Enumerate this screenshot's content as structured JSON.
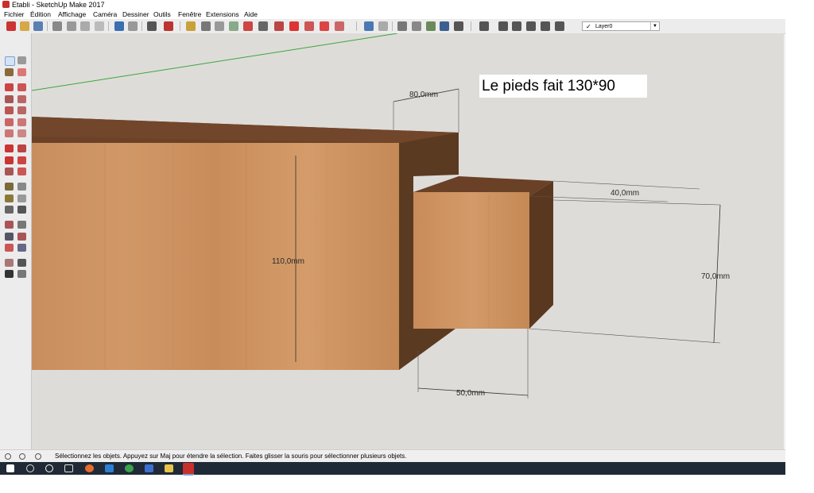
{
  "window": {
    "title": "Etabli - SketchUp Make 2017"
  },
  "menu": [
    "Fichier",
    "Édition",
    "Affichage",
    "Caméra",
    "Dessiner",
    "Outils",
    "Fenêtre",
    "Extensions",
    "Aide"
  ],
  "layer_selector": {
    "value": "Layer0",
    "check": "✓"
  },
  "viewport": {
    "note": "Le pieds fait 130*90",
    "dimensions": [
      "80,0mm",
      "40,0mm",
      "110,0mm",
      "70,0mm",
      "50,0mm"
    ],
    "colors": {
      "background": "#dedcd9",
      "wood_front": "#c98f5f",
      "wood_top": "#6a4126",
      "wood_side": "#5a3a22",
      "axis_green": "#3aa63a"
    }
  },
  "status": {
    "message": "Sélectionnez les objets. Appuyez sur Maj pour étendre la sélection. Faites glisser la souris pour sélectionner plusieurs objets."
  },
  "taskbar": {
    "icons": [
      "windows-start-icon",
      "search-icon",
      "cortana-icon",
      "task-view-icon",
      "firefox-icon",
      "edge-icon",
      "chrome-icon",
      "store-icon",
      "file-explorer-icon",
      "sketchup-icon"
    ]
  }
}
